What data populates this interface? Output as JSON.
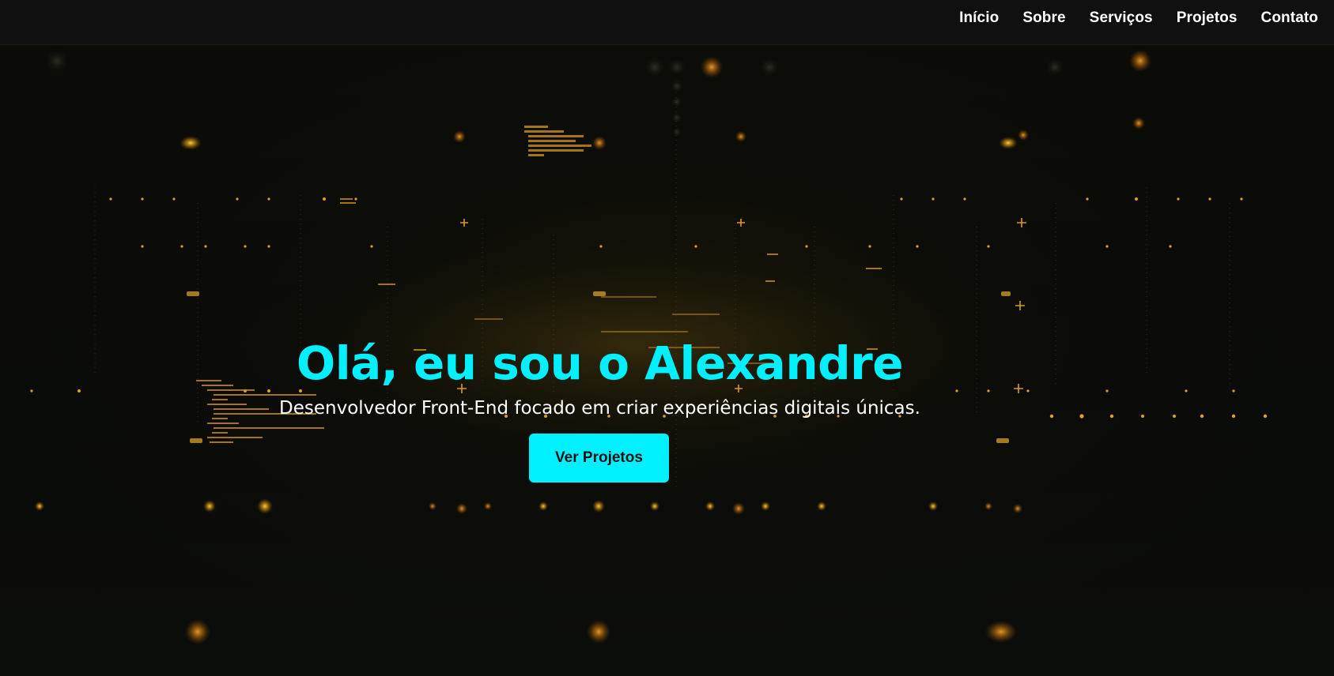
{
  "nav": {
    "items": [
      {
        "label": "Início"
      },
      {
        "label": "Sobre"
      },
      {
        "label": "Serviços"
      },
      {
        "label": "Projetos"
      },
      {
        "label": "Contato"
      }
    ]
  },
  "hero": {
    "title": "Olá, eu sou o Alexandre",
    "subtitle": "Desenvolvedor Front-End focado em criar experiências digitais únicas.",
    "cta_label": "Ver Projetos"
  },
  "colors": {
    "accent": "#00f0ff",
    "background": "#080808",
    "header": "#101010",
    "glow": "#e0a020"
  }
}
